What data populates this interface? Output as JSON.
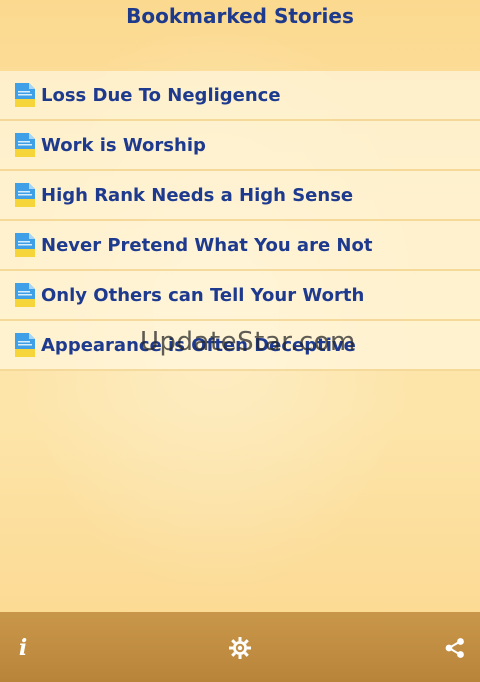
{
  "header": {
    "title": "Bookmarked Stories"
  },
  "bookmarks": [
    {
      "label": "Loss Due To Negligence",
      "icon": "document-icon"
    },
    {
      "label": "Work is Worship",
      "icon": "document-icon"
    },
    {
      "label": "High Rank Needs a High Sense",
      "icon": "document-icon"
    },
    {
      "label": "Never Pretend What You are Not",
      "icon": "document-icon"
    },
    {
      "label": "Only Others can Tell Your Worth",
      "icon": "document-icon"
    },
    {
      "label": "Appearance is Often Deceptive",
      "icon": "document-icon"
    }
  ],
  "watermark": {
    "text": "UpdateStar.com"
  },
  "toolbar": {
    "info_icon": "info-icon",
    "settings_icon": "settings-gear-icon",
    "share_icon": "share-icon",
    "bar_color": "#c18e44"
  }
}
